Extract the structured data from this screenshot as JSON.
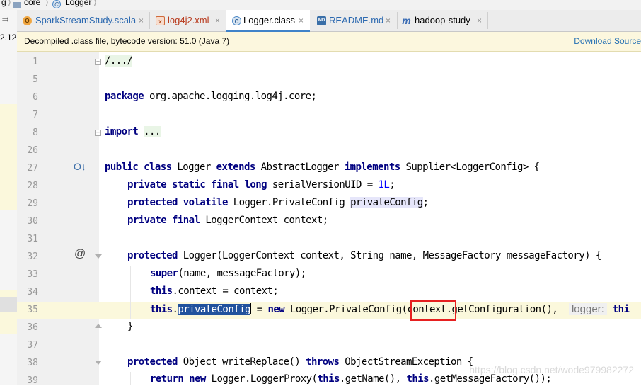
{
  "breadcrumb": {
    "items": [
      "g",
      "core",
      "Logger"
    ],
    "sep": "⟩"
  },
  "tabs": [
    {
      "label": "SparkStreamStudy.scala",
      "icon": "O",
      "close": "×"
    },
    {
      "label": "log4j2.xml",
      "icon": "x",
      "close": "×"
    },
    {
      "label": "Logger.class",
      "icon": "C",
      "close": "×"
    },
    {
      "label": "README.md",
      "icon": "MD",
      "close": "×"
    },
    {
      "label": "hadoop-study",
      "icon": "m",
      "close": "×"
    }
  ],
  "sidebar": {
    "version": "2.12",
    "pin_icon": "pin-icon"
  },
  "banner": {
    "message": "Decompiled .class file, bytecode version: 51.0 (Java 7)",
    "action": "Download Source"
  },
  "editor": {
    "line_numbers": [
      "1",
      "5",
      "6",
      "7",
      "8",
      "26",
      "27",
      "28",
      "29",
      "30",
      "31",
      "32",
      "33",
      "34",
      "35",
      "36",
      "37",
      "38",
      "39"
    ],
    "current_line": "35",
    "lines": {
      "l1": {
        "collapsed": "/.../"
      },
      "l6": {
        "kw": "package",
        "rest": " org.apache.logging.log4j.core;"
      },
      "l8": {
        "kw": "import",
        "collapsed": "..."
      },
      "l27": {
        "k1": "public class",
        "t1": " Logger ",
        "k2": "extends",
        "t2": " AbstractLogger ",
        "k3": "implements",
        "t3": " Supplier<LoggerConfig> {"
      },
      "l28": {
        "kw": "private static final long",
        "t1": " serialVersionUID = ",
        "num": "1L",
        "t2": ";"
      },
      "l29": {
        "kw": "protected volatile",
        "t1": " Logger.PrivateConfig ",
        "field": "privateConfig",
        "t2": ";"
      },
      "l30": {
        "kw": "private final",
        "t1": " LoggerContext context;"
      },
      "l32": {
        "kw": "protected",
        "t1": " Logger(LoggerContext context, String name, MessageFactory messageFactory) {"
      },
      "l33": {
        "kw": "super",
        "t1": "(name, messageFactory);"
      },
      "l34": {
        "kw": "this",
        "t1": ".context = context;"
      },
      "l35": {
        "kw": "this",
        "dot": ".",
        "sel": "privateConfig",
        "t1": " = ",
        "kw2": "new",
        "t2": " Logger.PrivateConfig",
        "boxed": "(context",
        "t3": ".getConfiguration(),  ",
        "hint": "logger:",
        "kw3": "thi"
      },
      "l36": {
        "t1": "}"
      },
      "l38": {
        "kw": "protected",
        "t1": " Object writeReplace() ",
        "kw2": "throws",
        "t2": " ObjectStreamException {"
      },
      "l39": {
        "kw": "return new",
        "t1": " Logger.LoggerProxy(",
        "kw2": "this",
        "t2": ".getName(), ",
        "kw3": "this",
        "t3": ".getMessageFactory());"
      }
    }
  },
  "gutter_icons": {
    "line27": "O↓",
    "line32": "@"
  },
  "watermark": "https://blog.csdn.net/wode979982272"
}
